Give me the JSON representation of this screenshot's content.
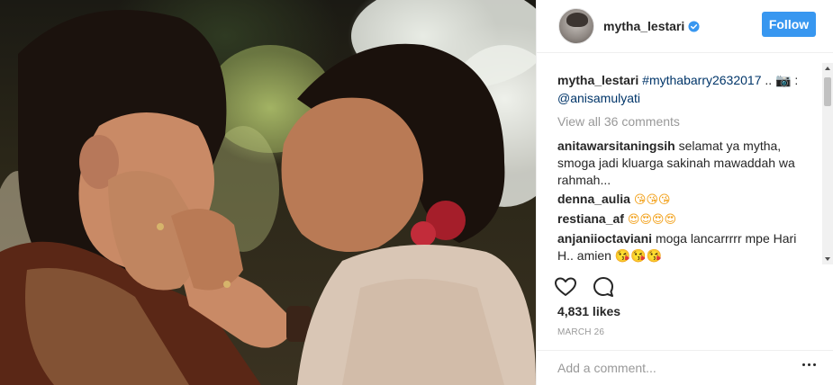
{
  "post": {
    "image_alt": "Couple portrait"
  },
  "header": {
    "username": "mytha_lestari",
    "verified": true,
    "follow_label": "Follow",
    "accent": "#3897f0"
  },
  "caption": {
    "username": "mytha_lestari",
    "hashtag": "#mythabarry2632017",
    "separator": "..",
    "camera_emoji": "📷",
    "colon": ":",
    "mention": "@anisamulyati"
  },
  "view_all": "View all 36 comments",
  "comments": [
    {
      "username": "anitawarsitaningsih",
      "text": "selamat ya mytha, smoga jadi kluarga sakinah mawaddah wa rahmah..."
    },
    {
      "username": "denna_aulia",
      "text": "😘😘😘"
    },
    {
      "username": "restiana_af",
      "text": "😍😍😍😍"
    },
    {
      "username": "anjaniioctaviani",
      "text": "moga lancarrrrr mpe Hari H.. amien 😘😘😘"
    }
  ],
  "actions": {
    "like_icon": "heart-icon",
    "comment_icon": "comment-bubble-icon"
  },
  "likes": "4,831 likes",
  "date": "MARCH 26",
  "add_comment": {
    "placeholder": "Add a comment..."
  }
}
